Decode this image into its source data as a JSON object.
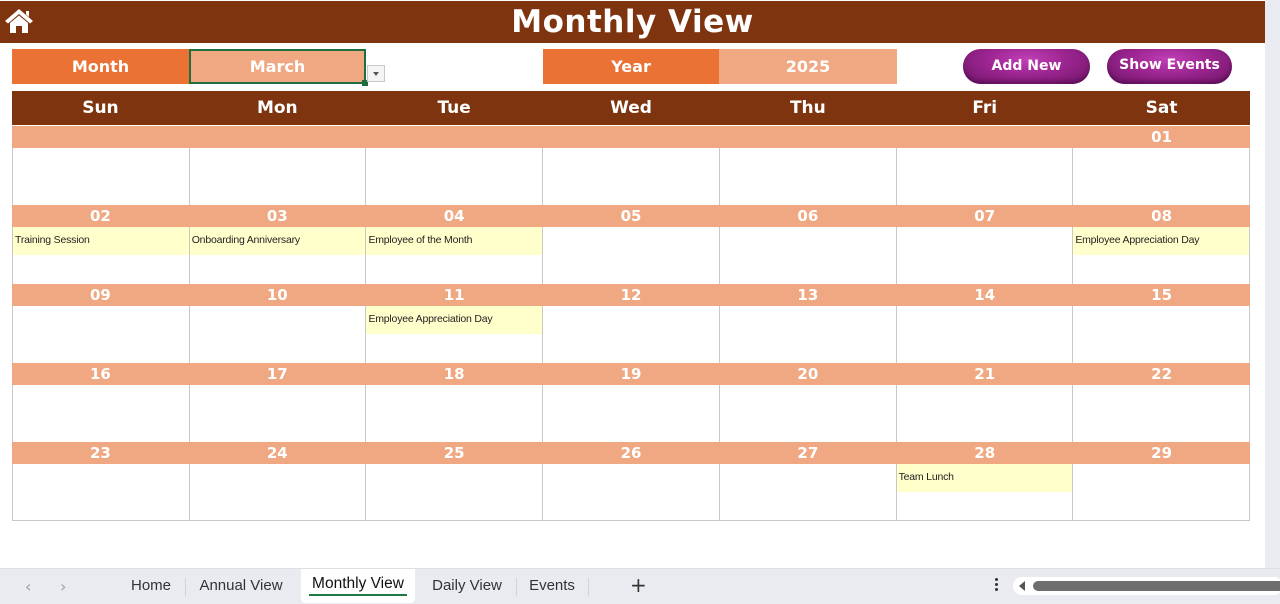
{
  "header": {
    "title": "Monthly View",
    "home_icon": "home-icon"
  },
  "controls": {
    "month_label": "Month",
    "month_value": "March",
    "year_label": "Year",
    "year_value": "2025",
    "add_new_label": "Add New",
    "show_events_label": "Show Events"
  },
  "colors": {
    "header_brown": "#7e340e",
    "label_orange": "#ea7234",
    "value_peach": "#f0a883",
    "button_purple": "#9b2590",
    "event_yellow": "#ffffcc",
    "active_tab_underline": "#1e7a45"
  },
  "weekdays": [
    "Sun",
    "Mon",
    "Tue",
    "Wed",
    "Thu",
    "Fri",
    "Sat"
  ],
  "weeks": [
    {
      "dates": [
        "",
        "",
        "",
        "",
        "",
        "",
        "01"
      ],
      "events": [
        "",
        "",
        "",
        "",
        "",
        "",
        ""
      ]
    },
    {
      "dates": [
        "02",
        "03",
        "04",
        "05",
        "06",
        "07",
        "08"
      ],
      "events": [
        "Training Session",
        "Onboarding Anniversary",
        "Employee of the Month",
        "",
        "",
        "",
        "Employee Appreciation Day"
      ]
    },
    {
      "dates": [
        "09",
        "10",
        "11",
        "12",
        "13",
        "14",
        "15"
      ],
      "events": [
        "",
        "",
        "Employee Appreciation Day",
        "",
        "",
        "",
        ""
      ]
    },
    {
      "dates": [
        "16",
        "17",
        "18",
        "19",
        "20",
        "21",
        "22"
      ],
      "events": [
        "",
        "",
        "",
        "",
        "",
        "",
        ""
      ]
    },
    {
      "dates": [
        "23",
        "24",
        "25",
        "26",
        "27",
        "28",
        "29"
      ],
      "events": [
        "",
        "",
        "",
        "",
        "",
        "Team Lunch",
        ""
      ]
    }
  ],
  "sheet_tabs": {
    "items": [
      {
        "label": "Home",
        "active": false
      },
      {
        "label": "Annual View",
        "active": false
      },
      {
        "label": "Monthly View",
        "active": true
      },
      {
        "label": "Daily View",
        "active": false
      },
      {
        "label": "Events",
        "active": false
      }
    ],
    "prev_icon": "‹",
    "next_icon": "›",
    "add_icon": "+"
  }
}
